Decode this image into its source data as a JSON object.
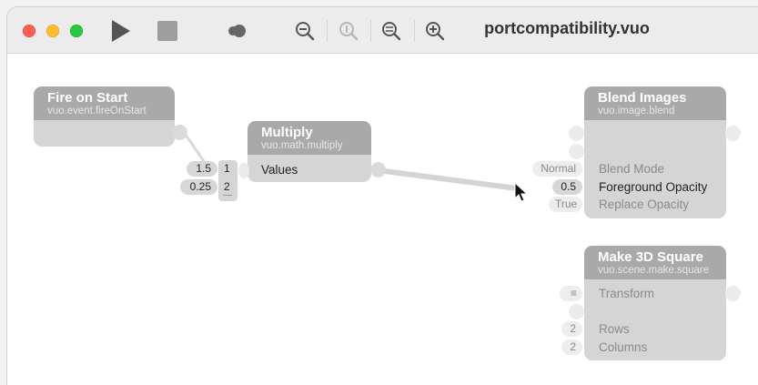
{
  "window": {
    "title": "portcompatibility.vuo"
  },
  "toolbar": {
    "icons": [
      "run-icon",
      "stop-icon",
      "show-events-icon",
      "zoom-out-icon",
      "actual-size-icon",
      "zoom-to-fit-icon",
      "zoom-in-icon"
    ]
  },
  "nodes": {
    "fire_on_start": {
      "title": "Fire on Start",
      "class": "vuo.event.fireOnStart"
    },
    "multiply": {
      "title": "Multiply",
      "class": "vuo.math.multiply",
      "port_label": "Values",
      "list_items": [
        "1",
        "2"
      ],
      "values": [
        "1.5",
        "0.25"
      ]
    },
    "blend_images": {
      "title": "Blend Images",
      "class": "vuo.image.blend",
      "ports": [
        {
          "label": "Blend Mode",
          "value": "Normal"
        },
        {
          "label": "Foreground Opacity",
          "value": "0.5"
        },
        {
          "label": "Replace Opacity",
          "value": "True"
        }
      ]
    },
    "make_3d_square": {
      "title": "Make 3D Square",
      "class": "vuo.scene.make.square",
      "ports": [
        {
          "label": "Transform",
          "value": "≡"
        },
        {
          "label": "Rows",
          "value": "2"
        },
        {
          "label": "Columns",
          "value": "2"
        }
      ]
    }
  },
  "colors": {
    "node_header": "#a9a9a9",
    "node_body": "#d5d5d5",
    "close": "#fe5f57",
    "minimize": "#febc2e",
    "zoom": "#28c840"
  }
}
